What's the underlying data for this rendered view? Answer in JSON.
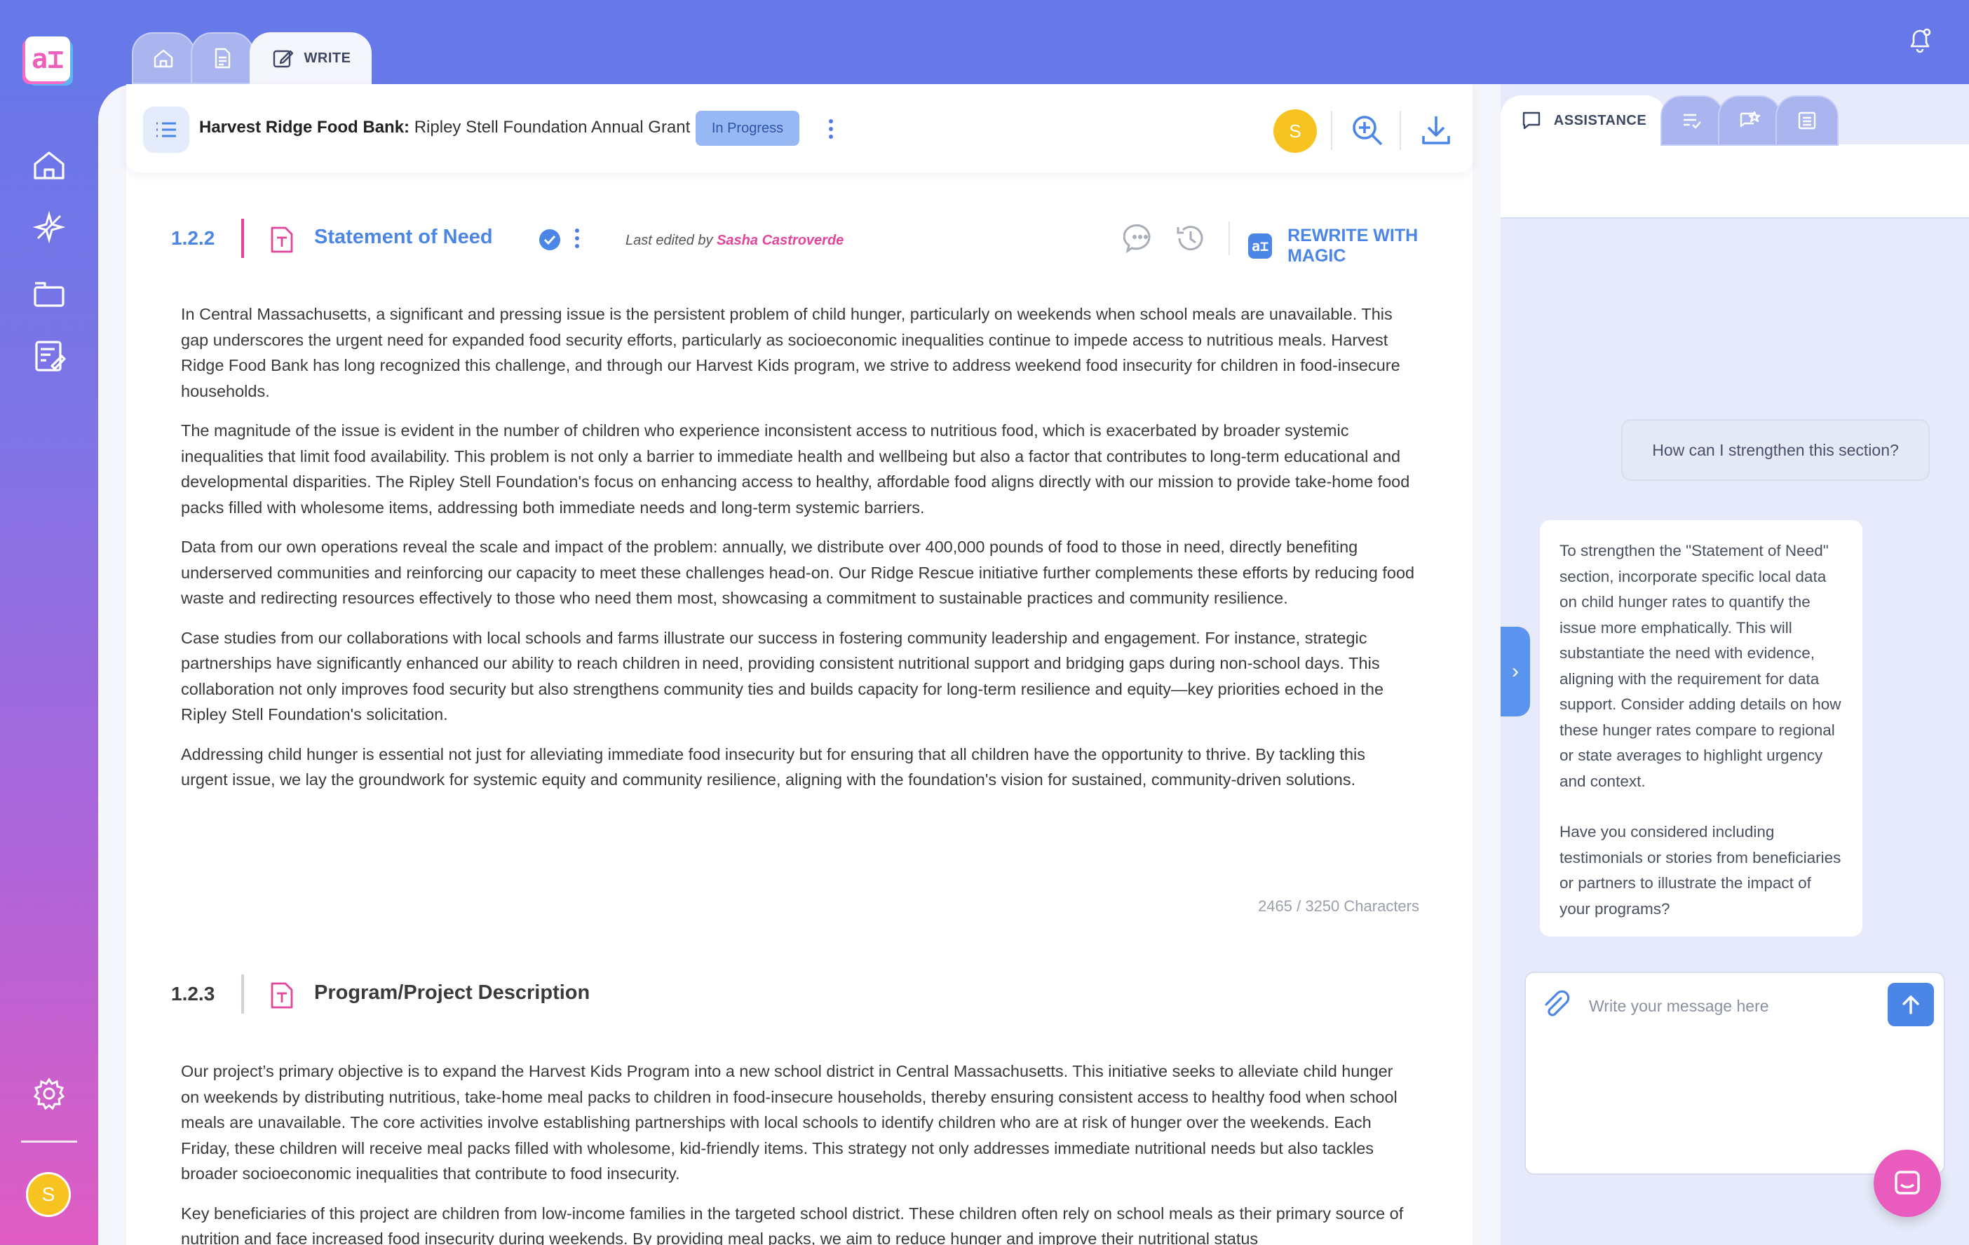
{
  "app": {
    "logo_text": "a⌶"
  },
  "sidebar": {
    "items": [
      {
        "icon": "home-icon"
      },
      {
        "icon": "sparkle-icon"
      },
      {
        "icon": "folder-icon"
      },
      {
        "icon": "document-edit-icon"
      }
    ],
    "settings_icon": "gear-icon",
    "avatar_initial": "S"
  },
  "tabs": [
    {
      "icon": "home-icon",
      "label": ""
    },
    {
      "icon": "document-icon",
      "label": ""
    },
    {
      "icon": "edit-icon",
      "label": "WRITE",
      "active": true
    }
  ],
  "header": {
    "org": "Harvest Ridge Food Bank:",
    "grant": "Ripley Stell Foundation Annual Grant",
    "status": "In Progress",
    "avatar_initial": "S"
  },
  "sections": [
    {
      "number": "1.2.2",
      "title": "Statement of Need",
      "verified": true,
      "last_edited_prefix": "Last edited by",
      "last_edited_by": "Sasha Castroverde",
      "rewrite_label": "REWRITE WITH MAGIC",
      "paragraphs": [
        "In Central Massachusetts, a significant and pressing issue is the persistent problem of child hunger, particularly on weekends when school meals are unavailable. This gap underscores the urgent need for expanded food security efforts, particularly as socioeconomic inequalities continue to impede access to nutritious meals. Harvest Ridge Food Bank has long recognized this challenge, and through our Harvest Kids program, we strive to address weekend food insecurity for children in food-insecure households.",
        "The magnitude of the issue is evident in the number of children who experience inconsistent access to nutritious food, which is exacerbated by broader systemic inequalities that limit food availability. This problem is not only a barrier to immediate health and wellbeing but also a factor that contributes to long-term educational and developmental disparities. The Ripley Stell Foundation's focus on enhancing access to healthy, affordable food aligns directly with our mission to provide take-home food packs filled with wholesome items, addressing both immediate needs and long-term systemic barriers.",
        "Data from our own operations reveal the scale and impact of the problem: annually, we distribute over 400,000 pounds of food to those in need, directly benefiting underserved communities and reinforcing our capacity to meet these challenges head-on. Our Ridge Rescue initiative further complements these efforts by reducing food waste and redirecting resources effectively to those who need them most, showcasing a commitment to sustainable practices and community resilience.",
        "Case studies from our collaborations with local schools and farms illustrate our success in fostering community leadership and engagement. For instance, strategic partnerships have significantly enhanced our ability to reach children in need, providing consistent nutritional support and bridging gaps during non-school days. This collaboration not only improves food security but also strengthens community ties and builds capacity for long-term resilience and equity—key priorities echoed in the Ripley Stell Foundation's solicitation.",
        "Addressing child hunger is essential not just for alleviating immediate food insecurity but for ensuring that all children have the opportunity to thrive. By tackling this urgent issue, we lay the groundwork for systemic equity and community resilience, aligning with the foundation's vision for sustained, community-driven solutions."
      ],
      "char_count": "2465 / 3250 Characters"
    },
    {
      "number": "1.2.3",
      "title": "Program/Project Description",
      "paragraphs": [
        "Our project’s primary objective is to expand the Harvest Kids Program into a new school district in Central Massachusetts. This initiative seeks to alleviate child hunger on weekends by distributing nutritious, take-home meal packs to children in food-insecure households, thereby ensuring consistent access to healthy food when school meals are unavailable. The core activities involve establishing partnerships with local schools to identify children who are at risk of hunger over the weekends. Each Friday, these children will receive meal packs filled with wholesome, kid-friendly items. This strategy not only addresses immediate nutritional needs but also tackles broader socioeconomic inequalities that contribute to food insecurity.",
        "Key beneficiaries of this project are children from low-income families in the targeted school district. These children often rely on school meals as their primary source of nutrition and face increased food insecurity during weekends. By providing meal packs, we aim to reduce hunger and improve their nutritional status"
      ]
    }
  ],
  "assistant": {
    "tabs": [
      {
        "icon": "chat-icon",
        "label": "ASSISTANCE",
        "active": true
      },
      {
        "icon": "checklist-icon",
        "label": ""
      },
      {
        "icon": "star-chat-icon",
        "label": ""
      },
      {
        "icon": "list-box-icon",
        "label": ""
      }
    ],
    "user_message": "How can I strengthen this section?",
    "ai_paragraphs": [
      "To strengthen the \"Statement of Need\" section, incorporate specific local data on child hunger rates to quantify the issue more emphatically. This will substantiate the need with evidence, aligning with the requirement for data support. Consider adding details on how these hunger rates compare to regional or state averages to highlight urgency and context.",
      "Have you considered including testimonials or stories from beneficiaries or partners to illustrate the impact of your programs?"
    ],
    "input_placeholder": "Write your message here",
    "input_value": ""
  },
  "colors": {
    "accent": "#4b86e6",
    "brand_pink": "#e2459c",
    "avatar": "#f6c320",
    "badge_bg": "#97b8f3"
  }
}
